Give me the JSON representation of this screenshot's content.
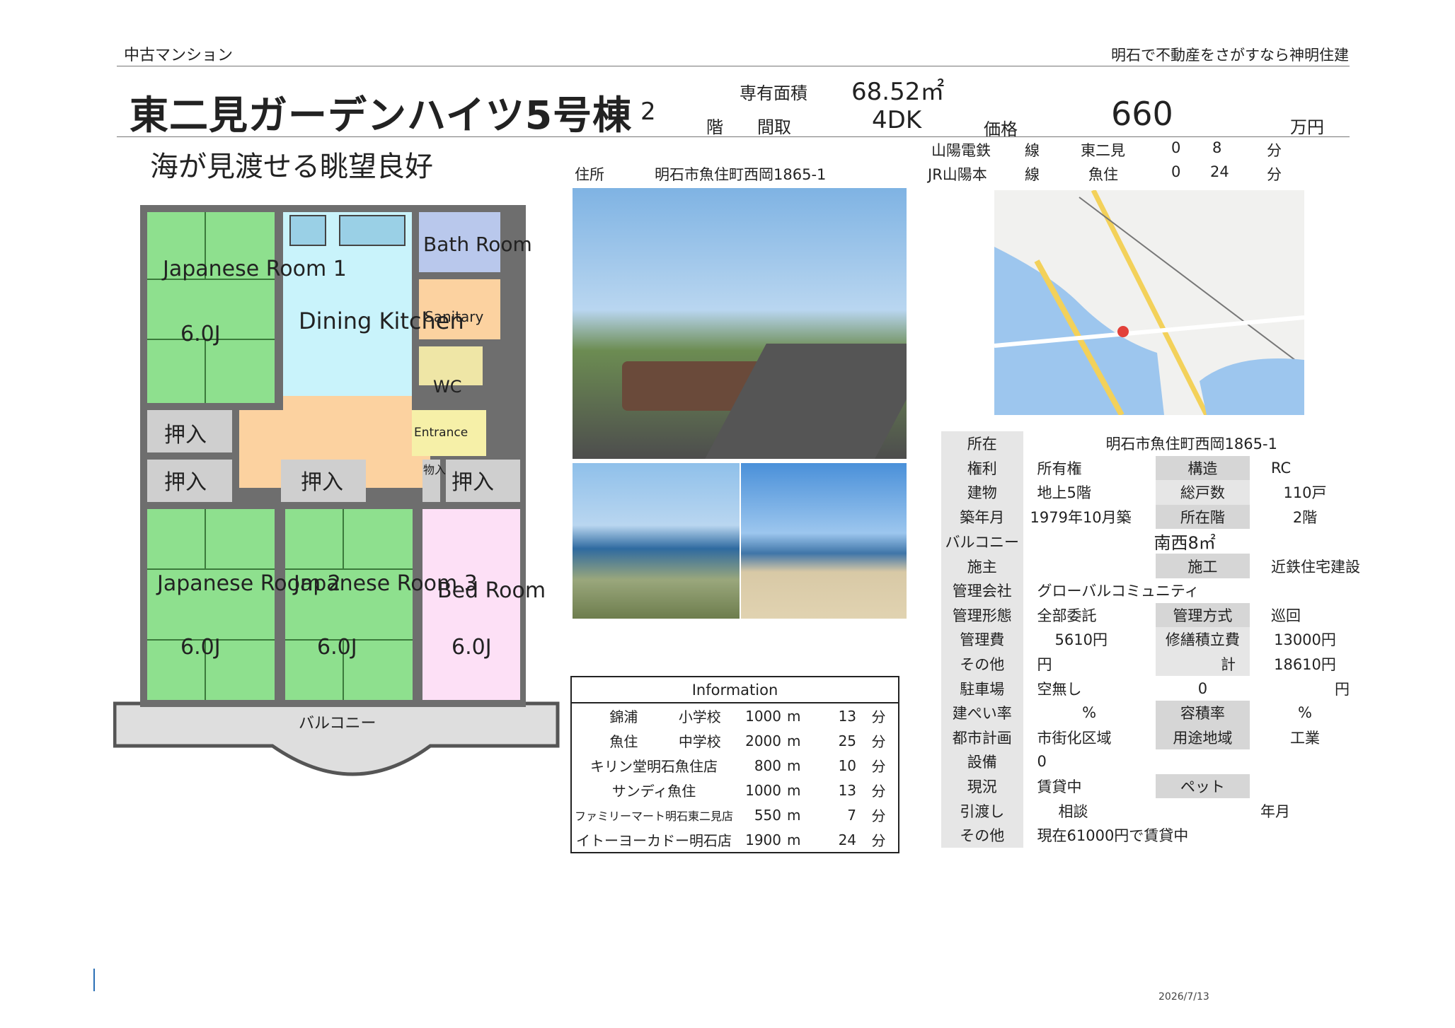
{
  "header": {
    "category": "中古マンション",
    "tagline": "明石で不動産をさがすなら神明住建"
  },
  "title": "東二見ガーデンハイツ5号棟",
  "floor": {
    "value": "2",
    "unit": "階"
  },
  "area": {
    "label": "専有面積",
    "value": "68.52㎡"
  },
  "layout": {
    "label": "間取",
    "value": "4DK"
  },
  "price": {
    "label": "価格",
    "value": "660",
    "unit": "万円"
  },
  "catchcopy": "海が見渡せる眺望良好",
  "address": {
    "label": "住所",
    "value": "明石市魚住町西岡1865-1"
  },
  "access": [
    {
      "line": "山陽電鉄",
      "sen": "線",
      "station": "東二見",
      "d1": "0",
      "d2": "8",
      "unit": "分"
    },
    {
      "line": "JR山陽本",
      "sen": "線",
      "station": "魚住",
      "d1": "0",
      "d2": "24",
      "unit": "分"
    }
  ],
  "floorplan": {
    "rooms": {
      "jr1": "Japanese Room 1",
      "jr1_size": "6.0J",
      "dk": "Dining Kitchen",
      "bath": "Bath Room",
      "sanitary": "Sanitary",
      "wc": "WC",
      "entrance": "Entrance",
      "jr2": "Japanese Room 2",
      "jr2_size": "6.0J",
      "jr3": "Japanese Room 3",
      "jr3_size": "6.0J",
      "bed": "Bed Room",
      "bed_size": "6.0J",
      "closet": "押入",
      "storage": "物入",
      "balcony": "バルコニー"
    }
  },
  "information": {
    "title": "Information",
    "rows": [
      {
        "name": "錦浦",
        "type": "小学校",
        "dist": "1000",
        "m": "m",
        "min": "13",
        "unit": "分"
      },
      {
        "name": "魚住",
        "type": "中学校",
        "dist": "2000",
        "m": "m",
        "min": "25",
        "unit": "分"
      },
      {
        "name": "キリン堂明石魚住店",
        "type": "",
        "dist": "800",
        "m": "m",
        "min": "10",
        "unit": "分"
      },
      {
        "name": "サンディ魚住",
        "type": "",
        "dist": "1000",
        "m": "m",
        "min": "13",
        "unit": "分"
      },
      {
        "name": "ファミリーマート明石東二見店",
        "type": "",
        "dist": "550",
        "m": "m",
        "min": "7",
        "unit": "分"
      },
      {
        "name": "イトーヨーカドー明石店",
        "type": "",
        "dist": "1900",
        "m": "m",
        "min": "24",
        "unit": "分"
      }
    ]
  },
  "spec": {
    "location_k": "所在",
    "location_v": "明石市魚住町西岡1865-1",
    "right_k": "権利",
    "right_v": "所有権",
    "struct_k": "構造",
    "struct_v": "RC",
    "bldg_k": "建物",
    "bldg_v": "地上5階",
    "units_k": "総戸数",
    "units_v": "110戸",
    "built_k": "築年月",
    "built_v": "1979年10月築",
    "flr_k": "所在階",
    "flr_v": "2階",
    "balc_k": "バルコニー",
    "balc_v": "南西8㎡",
    "owner_k": "施主",
    "owner_v": "",
    "builder_k": "施工",
    "builder_v": "近鉄住宅建設",
    "mgmt_k": "管理会社",
    "mgmt_v": "グローバルコミュニティ",
    "mform_k": "管理形態",
    "mform_v": "全部委託",
    "mstyle_k": "管理方式",
    "mstyle_v": "巡回",
    "fee_k": "管理費",
    "fee_v": "5610円",
    "repair_k": "修繕積立費",
    "repair_v": "13000円",
    "other_k": "その他",
    "other_v": "円",
    "total_k": "計",
    "total_v": "18610円",
    "park_k": "駐車場",
    "park_v": "空無し",
    "park_n": "0",
    "park_u": "円",
    "bcr_k": "建ぺい率",
    "bcr_u": "%",
    "far_k": "容積率",
    "far_u": "%",
    "plan_k": "都市計画",
    "plan_v": "市街化区域",
    "zone_k": "用途地域",
    "zone_v": "工業",
    "equip_k": "設備",
    "equip_v": "0",
    "status_k": "現況",
    "status_v": "賃貸中",
    "pet_k": "ペット",
    "pet_v": "",
    "handover_k": "引渡し",
    "handover_v": "相談",
    "handover_u": "年月",
    "other2_k": "その他",
    "other2_v": "現在61000円で賃貸中"
  },
  "footer": {
    "date": "2026/7/13"
  },
  "colors": {
    "tatami": "#8ee08e",
    "dk": "#c9f3fb",
    "corridor": "#fcd2a0",
    "bath": "#b9c8ec",
    "bed": "#fde0f6",
    "wall": "#6e6e6e",
    "closet": "#cfcfcf"
  }
}
